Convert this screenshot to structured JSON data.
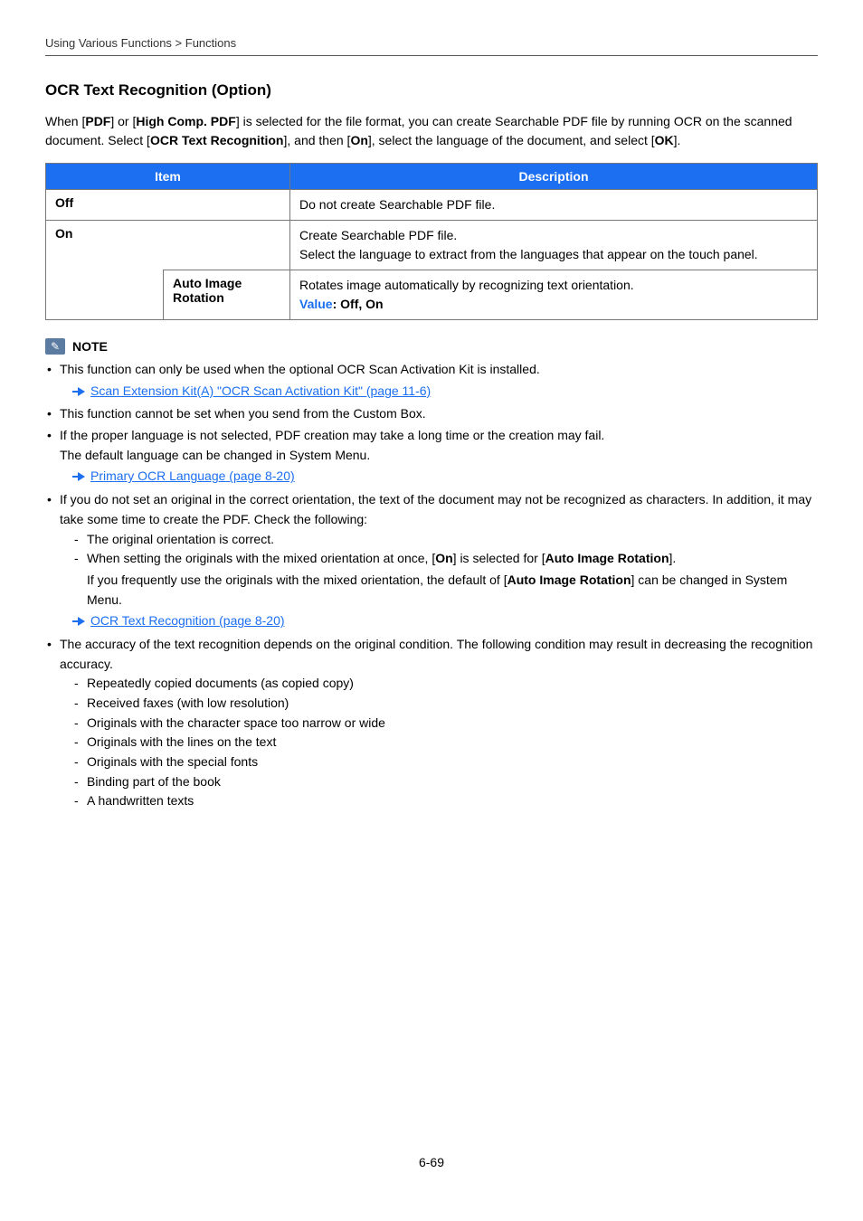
{
  "breadcrumb": "Using Various Functions > Functions",
  "title": "OCR Text Recognition (Option)",
  "intro_parts": {
    "p1a": "When [",
    "p1b": "PDF",
    "p1c": "] or [",
    "p1d": "High Comp. PDF",
    "p1e": "] is selected for the file format, you can create Searchable PDF file by running OCR on the scanned document. Select [",
    "p1f": "OCR Text Recognition",
    "p1g": "], and then [",
    "p1h": "On",
    "p1i": "], select the language of the document, and select [",
    "p1j": "OK",
    "p1k": "]."
  },
  "table": {
    "h_item": "Item",
    "h_desc": "Description",
    "row_off": {
      "item": "Off",
      "desc": "Do not create Searchable PDF file."
    },
    "row_on": {
      "item": "On",
      "desc_l1": "Create Searchable PDF file.",
      "desc_l2": "Select the language to extract from the languages that appear on the touch panel."
    },
    "row_sub": {
      "item": "Auto Image Rotation",
      "desc_l1": "Rotates image automatically by recognizing text orientation.",
      "value_label": "Value",
      "value_rest": ": Off, On"
    }
  },
  "note_label": "NOTE",
  "notes": {
    "n1": "This function can only be used when the optional OCR Scan Activation Kit is installed.",
    "link1": "Scan Extension Kit(A) \"OCR Scan Activation Kit\" (page 11-6)",
    "n2": "This function cannot be set when you send from the Custom Box.",
    "n3a": "If the proper language is not selected, PDF creation may take a long time or the creation may fail.",
    "n3b": "The default language can be changed in System Menu.",
    "link2": "Primary OCR Language (page 8-20)",
    "n4a": "If you do not set an original in the correct orientation, the text of the document may not be recognized as characters. In addition, it may take some time to create the PDF. Check the following:",
    "n4_d1": "The original orientation is correct.",
    "n4_d2a": "When setting the originals with the mixed orientation at once, [",
    "n4_d2b": "On",
    "n4_d2c": "] is selected for [",
    "n4_d2d": "Auto Image Rotation",
    "n4_d2e": "].",
    "n4_sub_a": "If you frequently use the originals with the mixed orientation, the default of [",
    "n4_sub_b": "Auto Image Rotation",
    "n4_sub_c": "] can be changed in System Menu.",
    "link3": "OCR Text Recognition (page 8-20)",
    "n5": "The accuracy of the text recognition depends on the original condition. The following condition may result in decreasing the recognition accuracy.",
    "n5_d1": "Repeatedly copied documents (as copied copy)",
    "n5_d2": "Received faxes (with low resolution)",
    "n5_d3": "Originals with the character space too narrow or wide",
    "n5_d4": "Originals with the lines on the text",
    "n5_d5": "Originals with the special fonts",
    "n5_d6": "Binding part of the book",
    "n5_d7": "A handwritten texts"
  },
  "page_num": "6-69"
}
